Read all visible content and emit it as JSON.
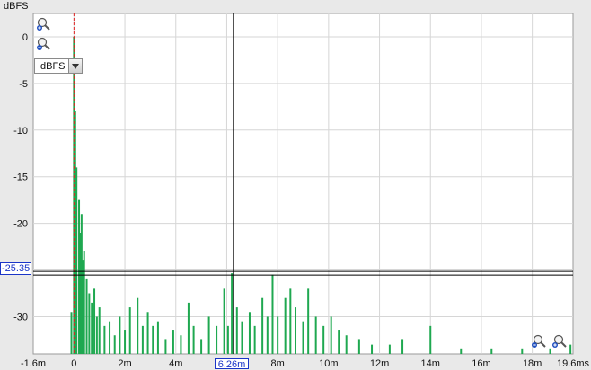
{
  "y_unit_label": "dBFS",
  "unit_selector": {
    "value": "dBFS"
  },
  "cursor": {
    "x_label": "6.26m",
    "y_label": "-25.35",
    "x_ms": 6.26,
    "y_db": -25.35
  },
  "colors": {
    "trace": "#1fa850",
    "plot_bg": "#ffffff",
    "grid": "#d6d6d6",
    "cursor": "#1a35c8",
    "marker": "#e02020"
  },
  "icons": {
    "zoom_in_top": "zoom-in-magnifier-icon",
    "zoom_out_top": "zoom-out-magnifier-icon",
    "zoom_out_bottom": "zoom-out-magnifier-icon",
    "zoom_in_bottom": "zoom-in-magnifier-icon"
  },
  "chart_data": {
    "type": "line",
    "title": "",
    "xlabel": "",
    "ylabel": "dBFS",
    "xlim": [
      -1.6,
      19.6
    ],
    "ylim": [
      -34,
      2.5
    ],
    "grid": true,
    "x_tick_values": [
      -1.6,
      0,
      2,
      4,
      6,
      8,
      10,
      12,
      14,
      16,
      18,
      19.6
    ],
    "x_tick_labels": [
      "-1.6m",
      "0",
      "2m",
      "4m",
      "6m",
      "8m",
      "10m",
      "12m",
      "14m",
      "16m",
      "18m",
      "19.6ms"
    ],
    "y_tick_values": [
      0,
      -5,
      -10,
      -15,
      -20,
      -25,
      -30
    ],
    "y_tick_labels": [
      "0",
      "-5",
      "-10",
      "-15",
      "-20",
      "-25",
      "-30"
    ],
    "series": [
      {
        "points": [
          [
            -0.1,
            -29.5
          ],
          [
            0.0,
            0.0
          ],
          [
            0.02,
            -4.0
          ],
          [
            0.05,
            -8.0
          ],
          [
            0.1,
            -14.0
          ],
          [
            0.2,
            -17.5
          ],
          [
            0.25,
            -21.0
          ],
          [
            0.3,
            -19.0
          ],
          [
            0.35,
            -24.0
          ],
          [
            0.4,
            -23.0
          ],
          [
            0.5,
            -26.0
          ],
          [
            0.6,
            -27.5
          ],
          [
            0.7,
            -28.5
          ],
          [
            0.8,
            -27.0
          ],
          [
            0.9,
            -30.0
          ],
          [
            1.0,
            -29.0
          ],
          [
            1.2,
            -31.0
          ],
          [
            1.4,
            -30.5
          ],
          [
            1.6,
            -32.0
          ],
          [
            1.8,
            -30.0
          ],
          [
            2.0,
            -31.5
          ],
          [
            2.2,
            -29.0
          ],
          [
            2.5,
            -28.0
          ],
          [
            2.7,
            -31.0
          ],
          [
            2.9,
            -29.5
          ],
          [
            3.1,
            -31.0
          ],
          [
            3.3,
            -30.5
          ],
          [
            3.6,
            -32.5
          ],
          [
            3.9,
            -31.5
          ],
          [
            4.2,
            -32.0
          ],
          [
            4.5,
            -28.5
          ],
          [
            4.7,
            -31.0
          ],
          [
            5.0,
            -32.5
          ],
          [
            5.3,
            -30.0
          ],
          [
            5.6,
            -31.0
          ],
          [
            5.9,
            -27.0
          ],
          [
            6.05,
            -31.0
          ],
          [
            6.2,
            -25.35
          ],
          [
            6.4,
            -29.0
          ],
          [
            6.6,
            -30.5
          ],
          [
            6.9,
            -29.5
          ],
          [
            7.1,
            -31.0
          ],
          [
            7.4,
            -28.0
          ],
          [
            7.6,
            -30.0
          ],
          [
            7.8,
            -25.5
          ],
          [
            8.0,
            -30.0
          ],
          [
            8.3,
            -28.0
          ],
          [
            8.5,
            -27.0
          ],
          [
            8.7,
            -29.0
          ],
          [
            9.0,
            -30.5
          ],
          [
            9.2,
            -27.0
          ],
          [
            9.5,
            -30.0
          ],
          [
            9.8,
            -31.0
          ],
          [
            10.1,
            -30.0
          ],
          [
            10.4,
            -31.5
          ],
          [
            10.7,
            -32.0
          ],
          [
            11.2,
            -32.5
          ],
          [
            11.7,
            -33.0
          ],
          [
            12.4,
            -33.0
          ],
          [
            12.9,
            -32.5
          ],
          [
            14.0,
            -31.0
          ],
          [
            15.2,
            -33.5
          ],
          [
            16.4,
            -33.5
          ],
          [
            17.6,
            -33.5
          ],
          [
            18.7,
            -33.5
          ],
          [
            19.5,
            -33.0
          ]
        ]
      }
    ]
  }
}
